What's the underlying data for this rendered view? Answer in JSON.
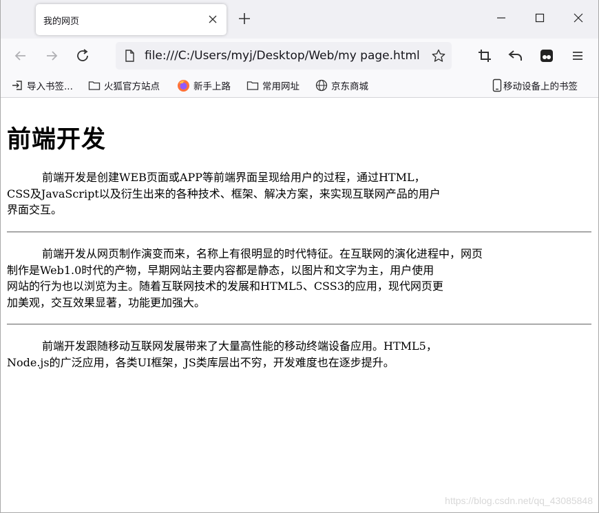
{
  "tab": {
    "title": "我的网页"
  },
  "nav": {
    "url": "file:///C:/Users/myj/Desktop/Web/my page.html"
  },
  "bookmarks": [
    {
      "label": "导入书签..."
    },
    {
      "label": "火狐官方站点"
    },
    {
      "label": "新手上路"
    },
    {
      "label": "常用网址"
    },
    {
      "label": "京东商城"
    }
  ],
  "mobile_bookmarks": "移动设备上的书签",
  "page": {
    "heading": "前端开发",
    "p1": [
      "前端开发是创建WEB页面或APP等前端界面呈现给用户的过程，通过HTML，",
      "CSS及JavaScript以及衍生出来的各种技术、框架、解决方案，来实现互联网产品的用户",
      "界面交互。"
    ],
    "p2": [
      "前端开发从网页制作演变而来，名称上有很明显的时代特征。在互联网的演化进程中，网页",
      "制作是Web1.0时代的产物，早期网站主要内容都是静态，以图片和文字为主，用户使用",
      "网站的行为也以浏览为主。随着互联网技术的发展和HTML5、CSS3的应用，现代网页更",
      "加美观，交互效果显著，功能更加强大。"
    ],
    "p3": [
      "前端开发跟随移动互联网发展带来了大量高性能的移动终端设备应用。HTML5，",
      "Node.js的广泛应用，各类UI框架，JS类库层出不穷，开发难度也在逐步提升。"
    ]
  },
  "watermark": "https://blog.csdn.net/qq_43085848"
}
